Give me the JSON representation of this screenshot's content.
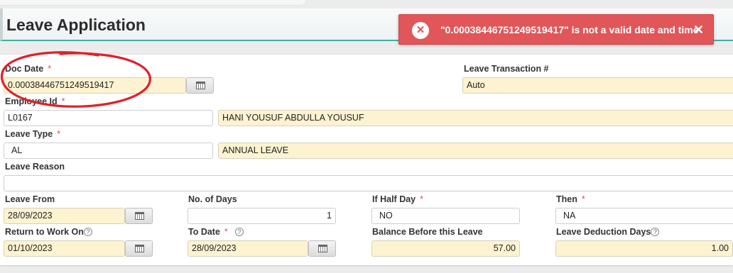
{
  "page": {
    "title": "Leave Application"
  },
  "toast": {
    "icon": "close-circle-icon",
    "message": "\"0.00038446751249519417\" is not a valid date and time",
    "close_glyph": "✕",
    "color": "#e15658"
  },
  "form": {
    "doc_date": {
      "label": "Doc Date",
      "required": "*",
      "value": "0.00038446751249519417"
    },
    "leave_transaction": {
      "label": "Leave Transaction #",
      "value": "Auto"
    },
    "employee": {
      "label": "Employee Id",
      "required": "*",
      "id": "L0167",
      "name": "HANI YOUSUF ABDULLA YOUSUF"
    },
    "leave_type": {
      "label": "Leave Type",
      "required": "*",
      "code": "AL",
      "description": "ANNUAL LEAVE"
    },
    "leave_reason": {
      "label": "Leave Reason",
      "value": ""
    },
    "leave_from": {
      "label": "Leave From",
      "value": "28/09/2023"
    },
    "no_of_days": {
      "label": "No. of Days",
      "value": "1"
    },
    "if_half_day": {
      "label": "If Half Day",
      "required": "*",
      "value": "NO"
    },
    "then": {
      "label": "Then",
      "required": "*",
      "value": "NA"
    },
    "return_to_work": {
      "label": "Return to Work On",
      "help": "?",
      "value": "01/10/2023"
    },
    "to_date": {
      "label": "To Date",
      "required": "*",
      "help": "?",
      "value": "28/09/2023"
    },
    "balance_before": {
      "label": "Balance Before this Leave",
      "value": "57.00"
    },
    "leave_deduction": {
      "label": "Leave Deduction Days",
      "help": "?",
      "value": "1.00"
    }
  },
  "annotation": {
    "color": "#e0202a"
  },
  "colors": {
    "accent": "#3bb3a6",
    "readonly_bg": "#fdf3d1",
    "required": "#d9534f"
  }
}
